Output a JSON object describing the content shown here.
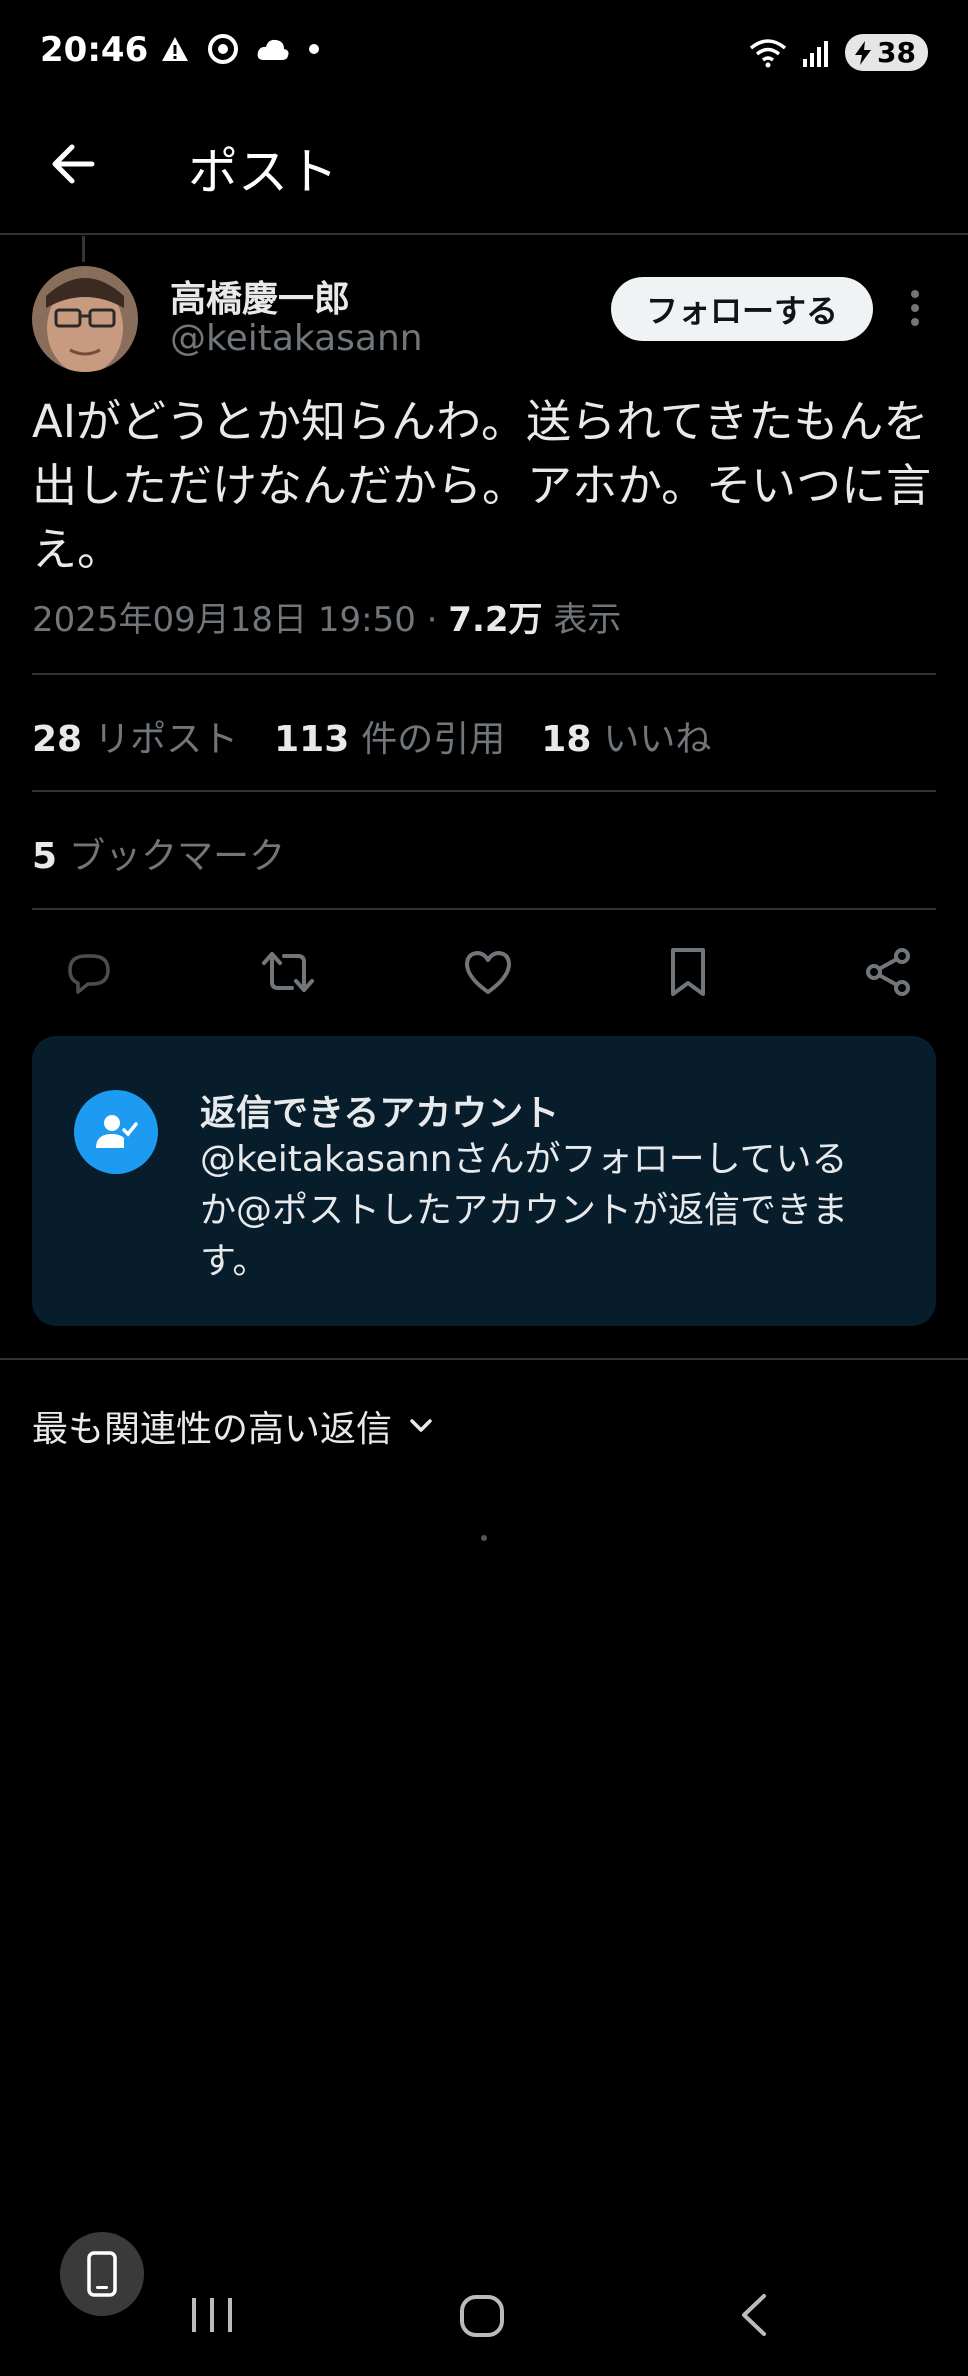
{
  "status_bar": {
    "time": "20:46",
    "battery": "38"
  },
  "header": {
    "title": "ポスト"
  },
  "post": {
    "display_name": "高橋慶一郎",
    "handle": "@keitakasann",
    "follow_label": "フォローする",
    "text": "AIがどうとか知らんわ。送られてきたもんを出しただけなんだから。アホか。そいつに言え。",
    "date": "2025年09月18日 19:50",
    "separator": "·",
    "views": "7.2万",
    "views_label": "表示"
  },
  "stats": {
    "reposts": "28",
    "reposts_label": "リポスト",
    "quotes": "113",
    "quotes_label": "件の引用",
    "likes": "18",
    "likes_label": "いいね",
    "bookmarks": "5",
    "bookmarks_label": "ブックマーク"
  },
  "reply_restriction": {
    "title": "返信できるアカウント",
    "description": "@keitakasannさんがフォローしているか@ポストしたアカウントが返信できます。"
  },
  "sort": {
    "label": "最も関連性の高い返信"
  },
  "colors": {
    "background": "#000000",
    "accent": "#1d9bf0",
    "card": "#071d2c",
    "muted": "#71767b"
  }
}
